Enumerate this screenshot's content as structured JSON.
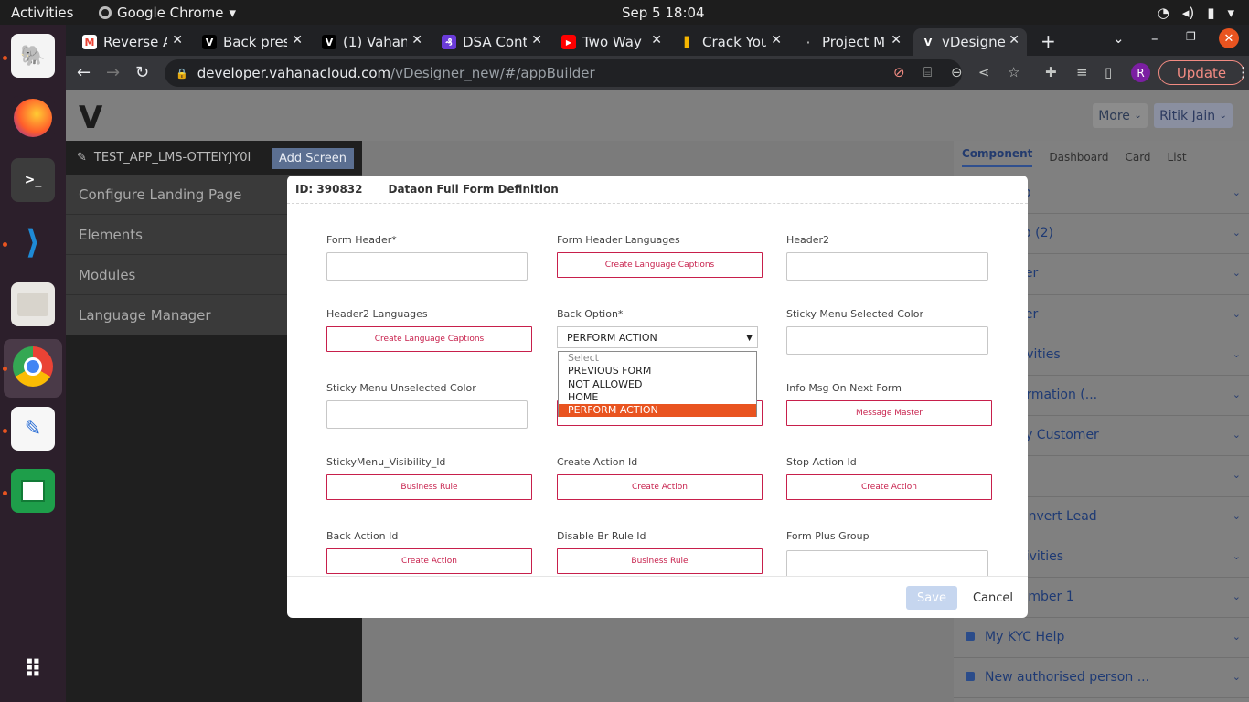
{
  "topbar": {
    "activities": "Activities",
    "app_name": "Google Chrome",
    "clock": "Sep 5  18:04"
  },
  "dock": {
    "apps": [
      "pgadmin-icon",
      "firefox-icon",
      "terminal-icon",
      "vscode-icon",
      "files-icon",
      "chrome-icon",
      "text-editor-icon",
      "spreadsheet-icon",
      "app-grid-icon"
    ]
  },
  "tabs": [
    {
      "title": "Reverse A",
      "icon": "gmail-icon"
    },
    {
      "title": "Back pres",
      "icon": "vahana-icon"
    },
    {
      "title": "(1) Vahan",
      "icon": "vahana-icon"
    },
    {
      "title": "DSA Cont",
      "icon": "dsa-icon"
    },
    {
      "title": "Two Way I",
      "icon": "youtube-icon"
    },
    {
      "title": "Crack You",
      "icon": "chart-icon"
    },
    {
      "title": "Project M",
      "icon": "project-icon"
    },
    {
      "title": "vDesigne",
      "icon": "vahana-icon"
    }
  ],
  "url": {
    "host": "developer.vahanacloud.com",
    "path": "/vDesigner_new/#/appBuilder"
  },
  "browser": {
    "profile_initial": "R",
    "update_label": "Update"
  },
  "app": {
    "more_label": "More",
    "user_label": "Ritik Jain",
    "app_name": "TEST_APP_LMS-OTTEIYJY0I",
    "add_screen": "Add Screen",
    "sidebar_items": [
      "Configure Landing Page",
      "Elements",
      "Modules",
      "Language Manager"
    ]
  },
  "right_panel": {
    "tabs": [
      "Component",
      "Dashboard",
      "Card",
      "List"
    ],
    "items": [
      "t Setup",
      "t Setup (2)",
      "ustomer",
      "ustomer",
      "er Activities",
      "er Information (...",
      "Activity Customer",
      "ers",
      "use Convert Lead",
      "ng Activities",
      "am Member 1",
      "My KYC Help",
      "New authorised person ..."
    ]
  },
  "modal": {
    "id": "ID: 390832",
    "title": "Dataon Full Form Definition",
    "fields": {
      "form_header": "Form Header*",
      "form_header_lang": "Form Header Languages",
      "header2": "Header2",
      "header2_lang": "Header2 Languages",
      "back_option": "Back Option*",
      "sticky_sel": "Sticky Menu Selected Color",
      "sticky_unsel": "Sticky Menu Unselected Color",
      "info_msg": "Info Msg On Next Form",
      "sticky_vis": "StickyMenu_Visibility_Id",
      "create_action_id": "Create Action Id",
      "stop_action_id": "Stop Action Id",
      "back_action_id": "Back Action Id",
      "disable_br": "Disable Br Rule Id",
      "form_plus_group": "Form Plus Group"
    },
    "buttons": {
      "create_lang": "Create Language Captions",
      "message_master": "Message Master",
      "business_rule": "Business Rule",
      "create_action": "Create Action"
    },
    "back_option_value": "PERFORM ACTION",
    "back_option_options": [
      "Select",
      "PREVIOUS FORM",
      "NOT ALLOWED",
      "HOME",
      "PERFORM ACTION"
    ],
    "save": "Save",
    "cancel": "Cancel"
  },
  "colors": {
    "accent": "#e95420",
    "crimson": "#c71f4b",
    "link": "#1e3a74"
  }
}
